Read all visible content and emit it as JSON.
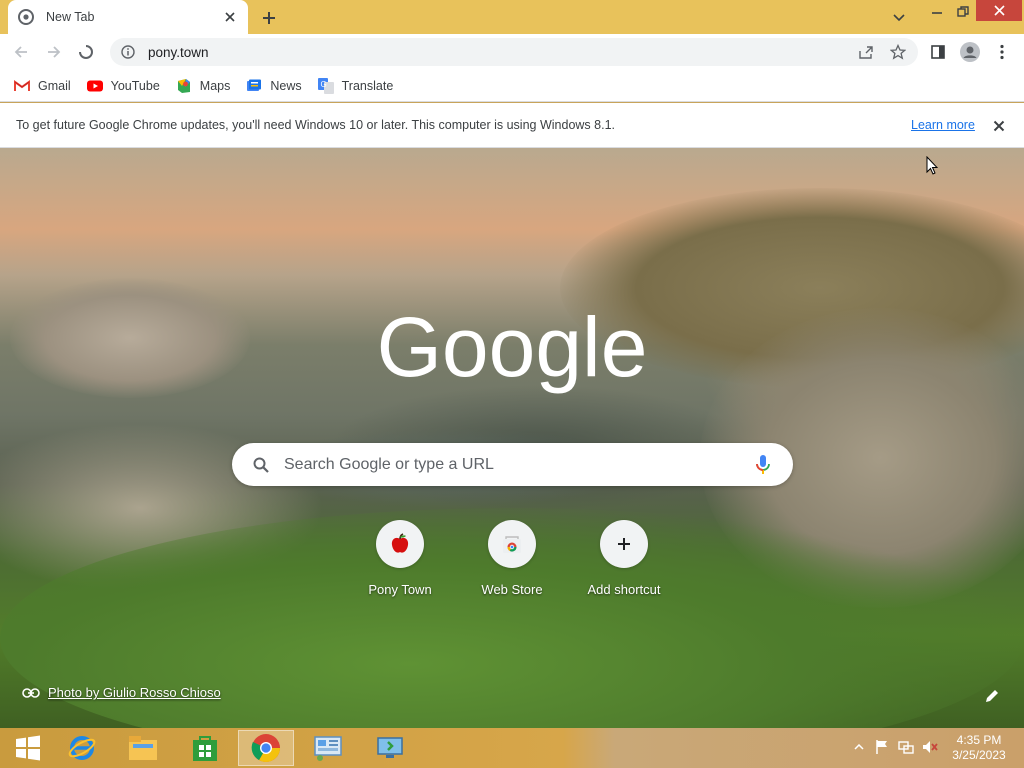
{
  "browser": {
    "tab": {
      "title": "New Tab"
    },
    "address": {
      "url": "pony.town"
    },
    "bookmarks": [
      {
        "label": "Gmail",
        "icon": "gmail-icon"
      },
      {
        "label": "YouTube",
        "icon": "youtube-icon"
      },
      {
        "label": "Maps",
        "icon": "maps-icon"
      },
      {
        "label": "News",
        "icon": "news-icon"
      },
      {
        "label": "Translate",
        "icon": "translate-icon"
      }
    ]
  },
  "infobar": {
    "message": "To get future Google Chrome updates, you'll need Windows 10 or later. This computer is using Windows 8.1.",
    "link": "Learn more"
  },
  "newtab": {
    "logo": "Google",
    "search_placeholder": "Search Google or type a URL",
    "shortcuts": [
      {
        "label": "Pony Town",
        "icon": "apple-icon"
      },
      {
        "label": "Web Store",
        "icon": "web-store-icon"
      },
      {
        "label": "Add shortcut",
        "icon": "plus-icon"
      }
    ],
    "photo_credit": "Photo by Giulio Rosso Chioso"
  },
  "taskbar": {
    "time": "4:35 PM",
    "date": "3/25/2023",
    "apps": [
      "start-icon",
      "internet-explorer-icon",
      "file-explorer-icon",
      "store-icon",
      "chrome-icon",
      "control-panel-icon",
      "remote-desktop-icon"
    ]
  },
  "colors": {
    "title_bar": "#e8c25b",
    "accent_blue": "#1a73e8",
    "window_close": "#c7463c"
  }
}
